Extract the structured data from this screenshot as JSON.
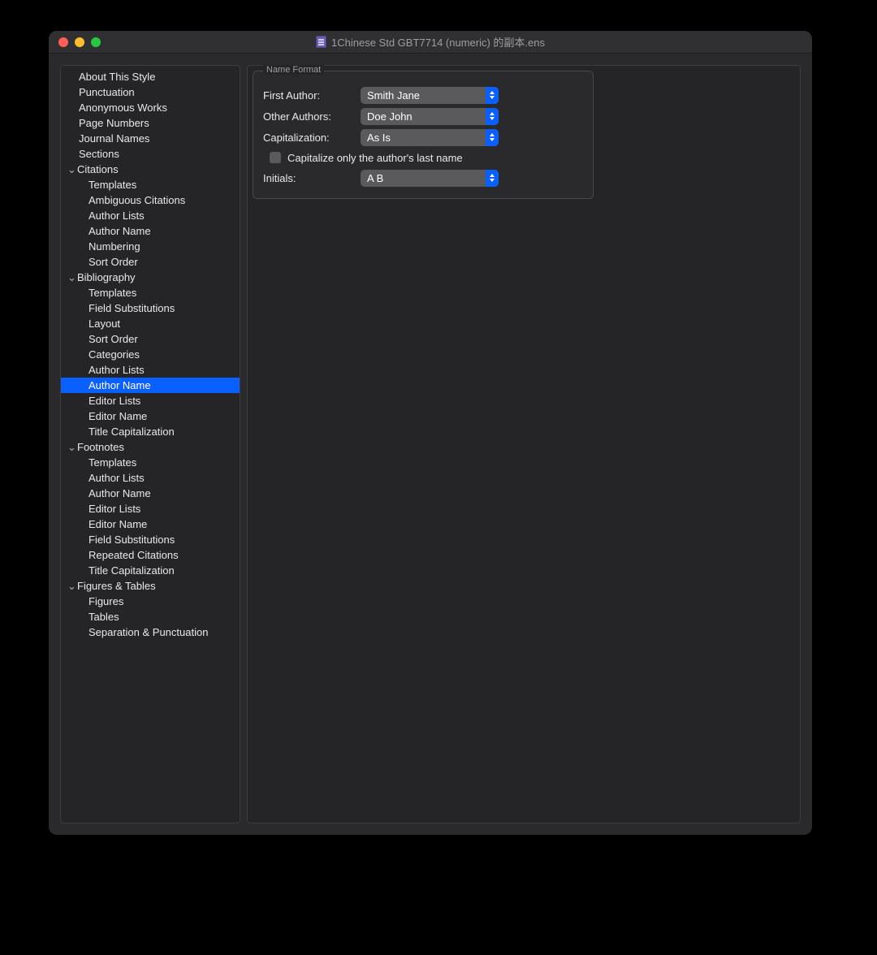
{
  "window": {
    "title": "1Chinese Std GBT7714 (numeric) 的副本.ens"
  },
  "sidebar": {
    "items": [
      {
        "label": "About This Style",
        "level": 1,
        "group": false,
        "selected": false
      },
      {
        "label": "Punctuation",
        "level": 1,
        "group": false,
        "selected": false
      },
      {
        "label": "Anonymous Works",
        "level": 1,
        "group": false,
        "selected": false
      },
      {
        "label": "Page Numbers",
        "level": 1,
        "group": false,
        "selected": false
      },
      {
        "label": "Journal Names",
        "level": 1,
        "group": false,
        "selected": false
      },
      {
        "label": "Sections",
        "level": 1,
        "group": false,
        "selected": false
      },
      {
        "label": "Citations",
        "level": 1,
        "group": true,
        "selected": false
      },
      {
        "label": "Templates",
        "level": 2,
        "group": false,
        "selected": false
      },
      {
        "label": "Ambiguous Citations",
        "level": 2,
        "group": false,
        "selected": false
      },
      {
        "label": "Author Lists",
        "level": 2,
        "group": false,
        "selected": false
      },
      {
        "label": "Author Name",
        "level": 2,
        "group": false,
        "selected": false
      },
      {
        "label": "Numbering",
        "level": 2,
        "group": false,
        "selected": false
      },
      {
        "label": "Sort Order",
        "level": 2,
        "group": false,
        "selected": false
      },
      {
        "label": "Bibliography",
        "level": 1,
        "group": true,
        "selected": false
      },
      {
        "label": "Templates",
        "level": 2,
        "group": false,
        "selected": false
      },
      {
        "label": "Field Substitutions",
        "level": 2,
        "group": false,
        "selected": false
      },
      {
        "label": "Layout",
        "level": 2,
        "group": false,
        "selected": false
      },
      {
        "label": "Sort Order",
        "level": 2,
        "group": false,
        "selected": false
      },
      {
        "label": "Categories",
        "level": 2,
        "group": false,
        "selected": false
      },
      {
        "label": "Author Lists",
        "level": 2,
        "group": false,
        "selected": false
      },
      {
        "label": "Author Name",
        "level": 2,
        "group": false,
        "selected": true
      },
      {
        "label": "Editor Lists",
        "level": 2,
        "group": false,
        "selected": false
      },
      {
        "label": "Editor Name",
        "level": 2,
        "group": false,
        "selected": false
      },
      {
        "label": "Title Capitalization",
        "level": 2,
        "group": false,
        "selected": false
      },
      {
        "label": "Footnotes",
        "level": 1,
        "group": true,
        "selected": false
      },
      {
        "label": "Templates",
        "level": 2,
        "group": false,
        "selected": false
      },
      {
        "label": "Author Lists",
        "level": 2,
        "group": false,
        "selected": false
      },
      {
        "label": "Author Name",
        "level": 2,
        "group": false,
        "selected": false
      },
      {
        "label": "Editor Lists",
        "level": 2,
        "group": false,
        "selected": false
      },
      {
        "label": "Editor Name",
        "level": 2,
        "group": false,
        "selected": false
      },
      {
        "label": "Field Substitutions",
        "level": 2,
        "group": false,
        "selected": false
      },
      {
        "label": "Repeated Citations",
        "level": 2,
        "group": false,
        "selected": false
      },
      {
        "label": "Title Capitalization",
        "level": 2,
        "group": false,
        "selected": false
      },
      {
        "label": "Figures & Tables",
        "level": 1,
        "group": true,
        "selected": false
      },
      {
        "label": "Figures",
        "level": 2,
        "group": false,
        "selected": false
      },
      {
        "label": "Tables",
        "level": 2,
        "group": false,
        "selected": false
      },
      {
        "label": "Separation & Punctuation",
        "level": 2,
        "group": false,
        "selected": false
      }
    ]
  },
  "panel": {
    "title": "Name Format",
    "rows": {
      "first_author": {
        "label": "First Author:",
        "value": "Smith Jane"
      },
      "other_authors": {
        "label": "Other Authors:",
        "value": "Doe John"
      },
      "capitalization": {
        "label": "Capitalization:",
        "value": "As Is"
      },
      "cap_checkbox": {
        "label": "Capitalize only the author's last name",
        "checked": false
      },
      "initials": {
        "label": "Initials:",
        "value": "A B"
      }
    }
  }
}
